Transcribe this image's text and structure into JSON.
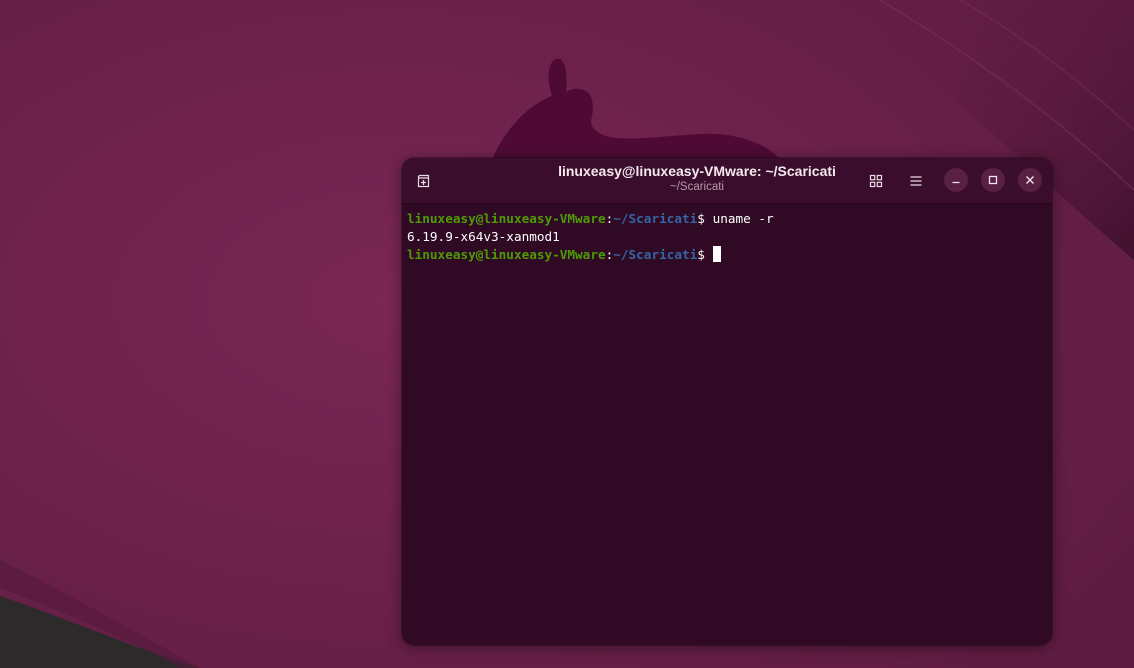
{
  "window": {
    "title": "linuxeasy@linuxeasy-VMware: ~/Scaricati",
    "subtitle": "~/Scaricati"
  },
  "headerbar": {
    "new_tab_icon": "new-tab-icon",
    "tab_overview_icon": "grid-icon",
    "menu_icon": "hamburger-menu-icon",
    "minimize_icon": "minimize-icon",
    "maximize_icon": "maximize-icon",
    "close_icon": "close-icon"
  },
  "terminal": {
    "lines": [
      {
        "user_host": "linuxeasy@linuxeasy-VMware",
        "sep": ":",
        "path": "~/Scaricati",
        "symbol": "$ ",
        "command": "uname -r"
      },
      {
        "output": "6.19.9-x64v3-xanmod1"
      },
      {
        "user_host": "linuxeasy@linuxeasy-VMware",
        "sep": ":",
        "path": "~/Scaricati",
        "symbol": "$ ",
        "command": ""
      }
    ]
  },
  "colors": {
    "desktop_bg": "#6a2149",
    "terminal_bg": "#300a24",
    "prompt_user": "#4e9a06",
    "prompt_path": "#3465a4",
    "text": "#ffffff"
  }
}
